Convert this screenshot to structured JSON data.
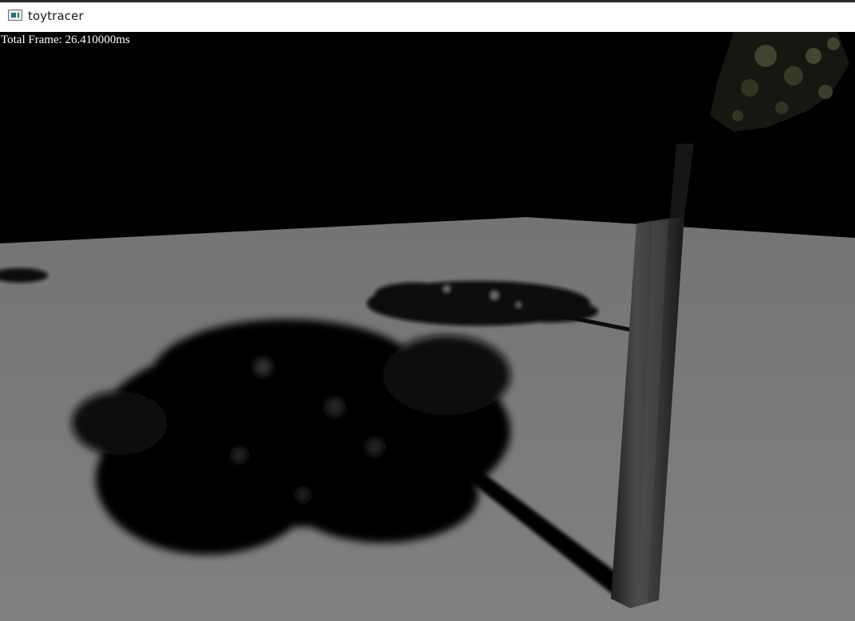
{
  "window": {
    "title": "toytracer",
    "icon": "app-window-icon"
  },
  "viewport": {
    "overlay_text": "Total Frame: 26.410000ms",
    "colors": {
      "sky": "#000000",
      "ground": "#7a7a7a",
      "shadow": "#050505",
      "trunk": "#3a3a3a",
      "leaves": "#4a4a36"
    }
  }
}
